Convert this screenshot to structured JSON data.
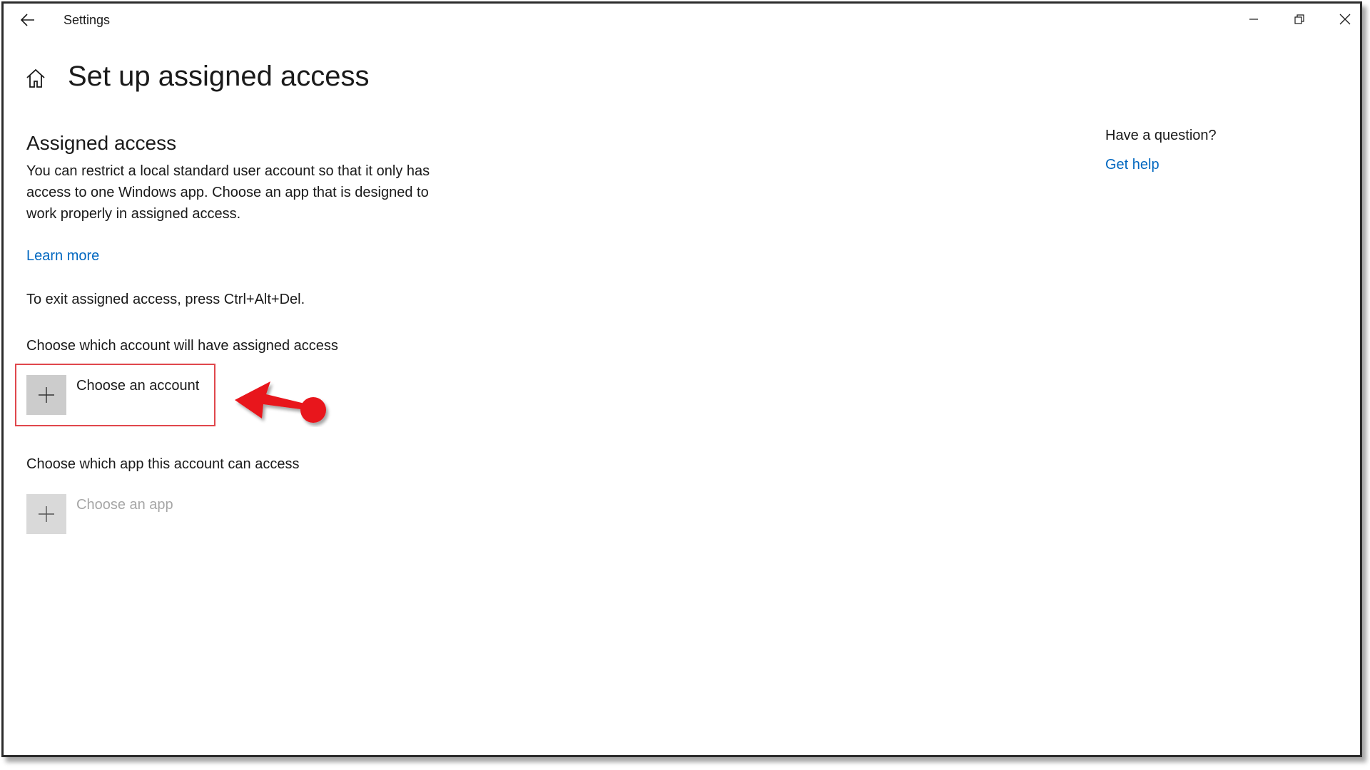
{
  "window": {
    "app_title": "Settings",
    "controls": {
      "minimize": "minimize-icon",
      "maximize": "restore-icon",
      "close": "close-icon"
    }
  },
  "page": {
    "title": "Set up assigned access",
    "home_icon": "home-icon"
  },
  "assigned_access": {
    "heading": "Assigned access",
    "description": "You can restrict a local standard user account so that it only has access to one Windows app. Choose an app that is designed to work properly in assigned access.",
    "learn_more": "Learn more",
    "exit_instructions": "To exit assigned access, press Ctrl+Alt+Del.",
    "account_section_label": "Choose which account will have assigned access",
    "choose_account_label": "Choose an account",
    "app_section_label": "Choose which app this account can access",
    "choose_app_label": "Choose an app"
  },
  "help": {
    "heading": "Have a question?",
    "link": "Get help"
  },
  "annotations": {
    "highlight_color": "#e0474c",
    "arrow_color": "#e8141b"
  },
  "colors": {
    "link": "#0067c0",
    "tile_bg": "#cccccc",
    "disabled_text": "#a6a6a6"
  }
}
